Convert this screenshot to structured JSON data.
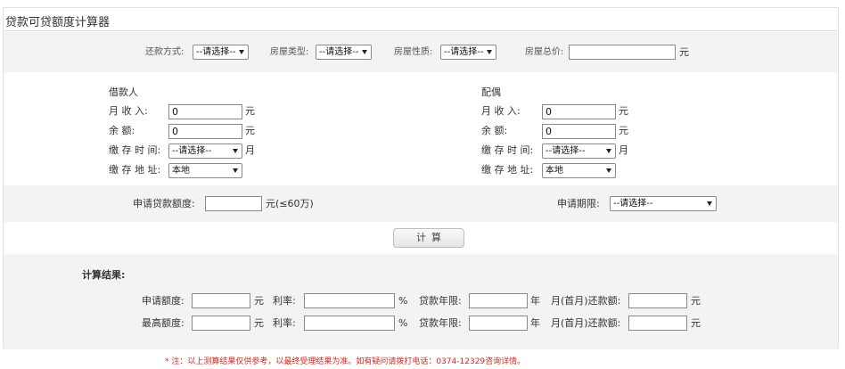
{
  "title": "贷款可贷额度计算器",
  "top_row": {
    "repay_label": "还款方式:",
    "repay_value": "--请选择--",
    "house_type_label": "房屋类型:",
    "house_type_value": "--请选择--",
    "house_nature_label": "房屋性质:",
    "house_nature_value": "--请选择--",
    "total_price_label": "房屋总价:",
    "total_price_value": "",
    "unit": "元"
  },
  "borrower": {
    "heading": "借款人",
    "income_label": "月  收  入:",
    "income_value": "0",
    "balance_label": "余        额:",
    "balance_value": "0",
    "deposit_time_label": "缴 存 时 间:",
    "deposit_time_value": "--请选择--",
    "month_unit": "月",
    "deposit_addr_label": "缴 存 地 址:",
    "deposit_addr_value": "本地",
    "unit": "元"
  },
  "spouse": {
    "heading": "配偶",
    "income_label": "月  收  入:",
    "income_value": "0",
    "balance_label": "余        额:",
    "balance_value": "0",
    "deposit_time_label": "缴 存 时 间:",
    "deposit_time_value": "--请选择--",
    "month_unit": "月",
    "deposit_addr_label": "缴 存 地 址:",
    "deposit_addr_value": "本地",
    "unit": "元"
  },
  "apply": {
    "amount_label": "申请贷款额度:",
    "amount_value": "",
    "amount_unit": "元(≤60万)",
    "term_label": "申请期限:",
    "term_value": "--请选择--"
  },
  "calc_button": "计算",
  "result": {
    "heading": "计算结果:",
    "row1": {
      "amount_label": "申请额度:",
      "amount_unit": "元",
      "rate_label": "利率:",
      "rate_unit": "%",
      "years_label": "贷款年限:",
      "years_unit": "年",
      "monthly_label": "月(首月)还款额:",
      "monthly_unit": "元"
    },
    "row2": {
      "amount_label": "最高额度:",
      "amount_unit": "元",
      "rate_label": "利率:",
      "rate_unit": "%",
      "years_label": "贷款年限:",
      "years_unit": "年",
      "monthly_label": "月(首月)还款额:",
      "monthly_unit": "元"
    }
  },
  "note": "* 注：以上测算结果仅供参考，以最终受理结果为准。如有疑问请拨打电话：0374-12329咨询详情。"
}
